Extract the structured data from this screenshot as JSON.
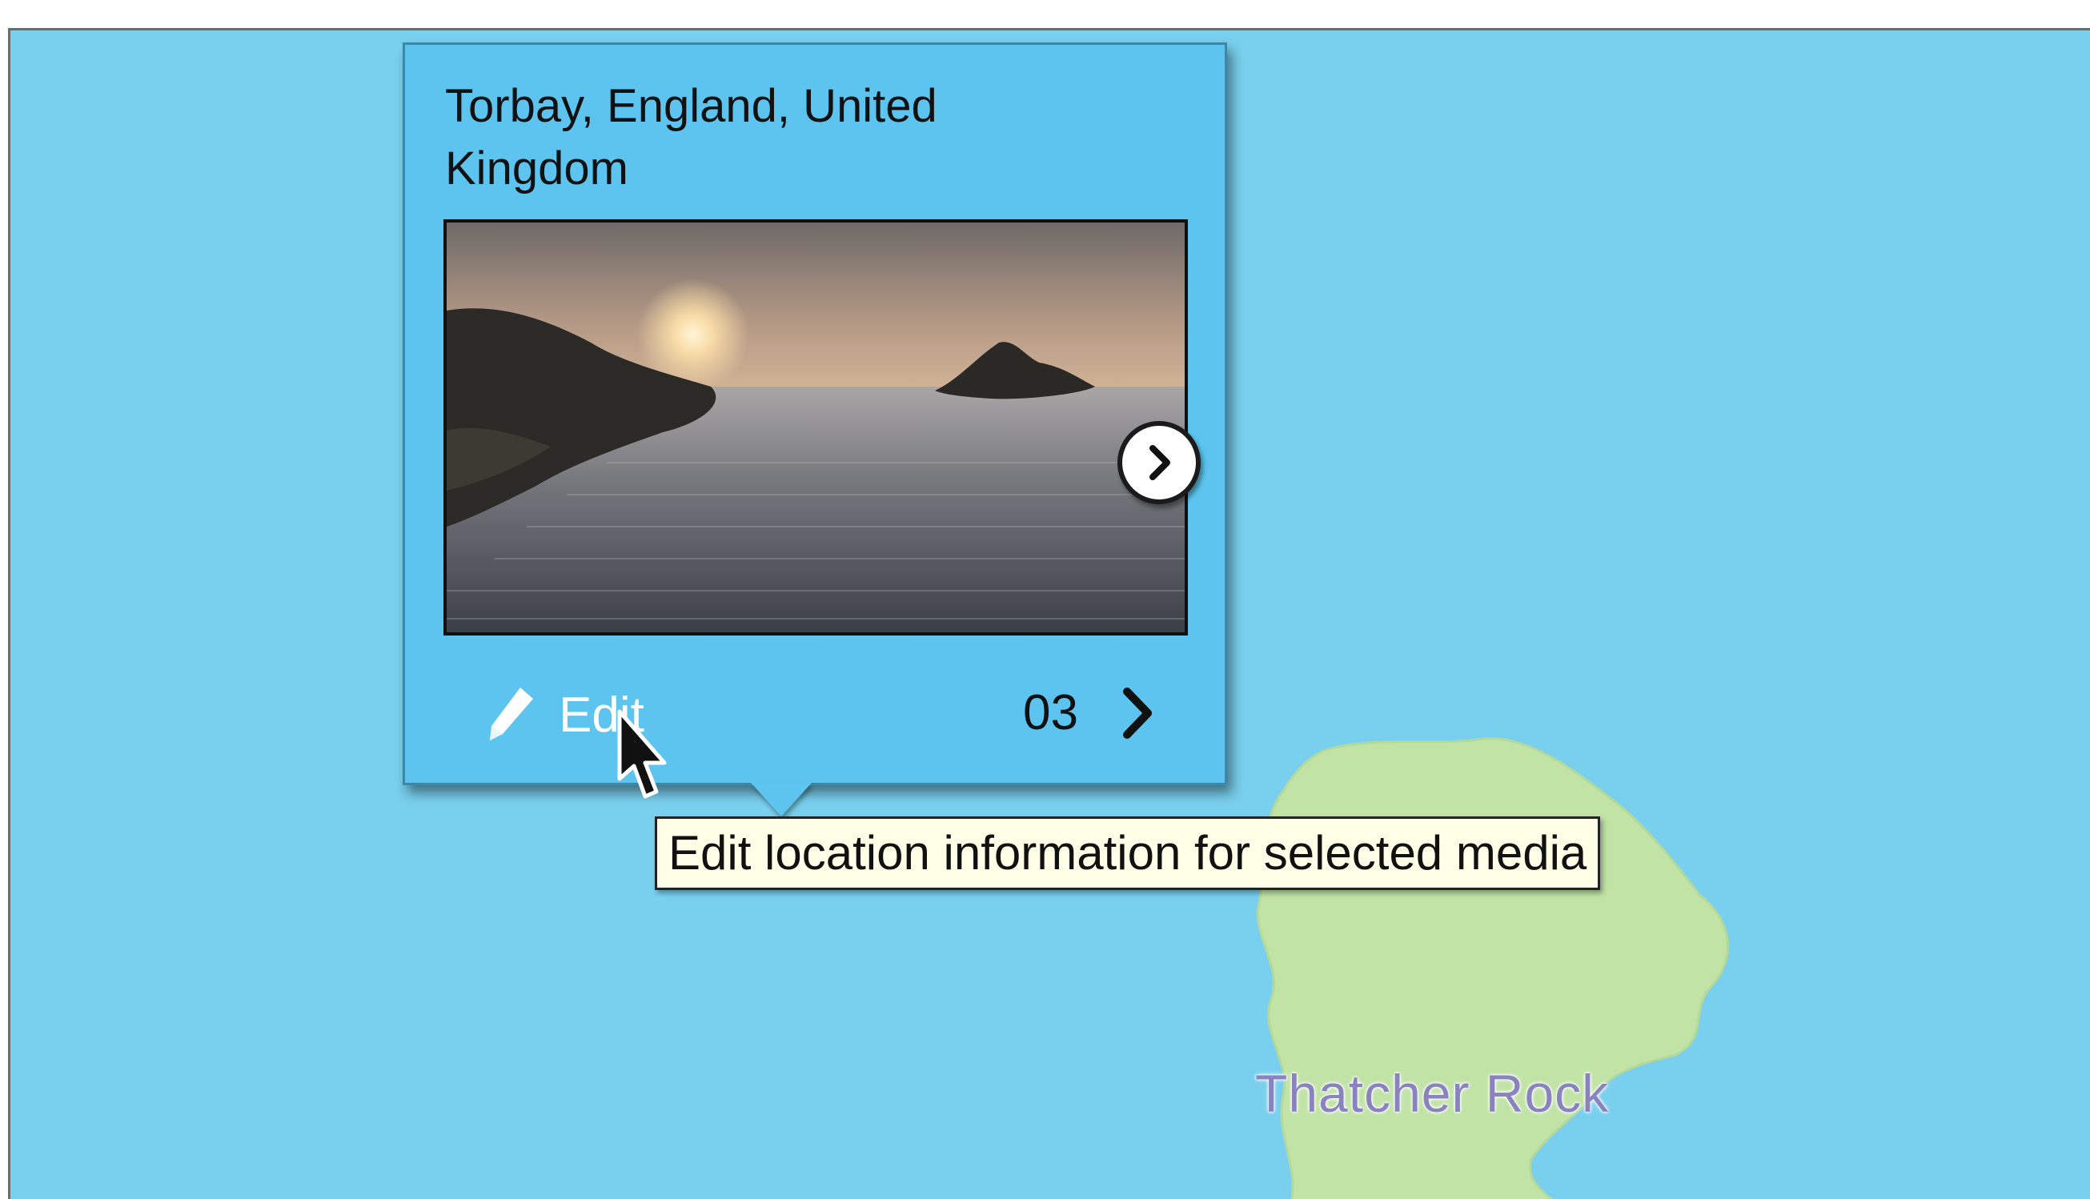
{
  "map": {
    "water_color": "#79d0ee",
    "land_color": "#c1e3a6",
    "place_label": "Thatcher Rock"
  },
  "popup": {
    "location_title": "Torbay, England, United Kingdom",
    "photo_next_icon": "chevron-right-circle-icon",
    "edit_icon": "pencil-icon",
    "edit_label": "Edit",
    "media_count": "03",
    "count_icon": "chevron-right-icon"
  },
  "tooltip": {
    "text": "Edit location information for selected media"
  },
  "cursor_icon": "arrow-pointer-icon"
}
